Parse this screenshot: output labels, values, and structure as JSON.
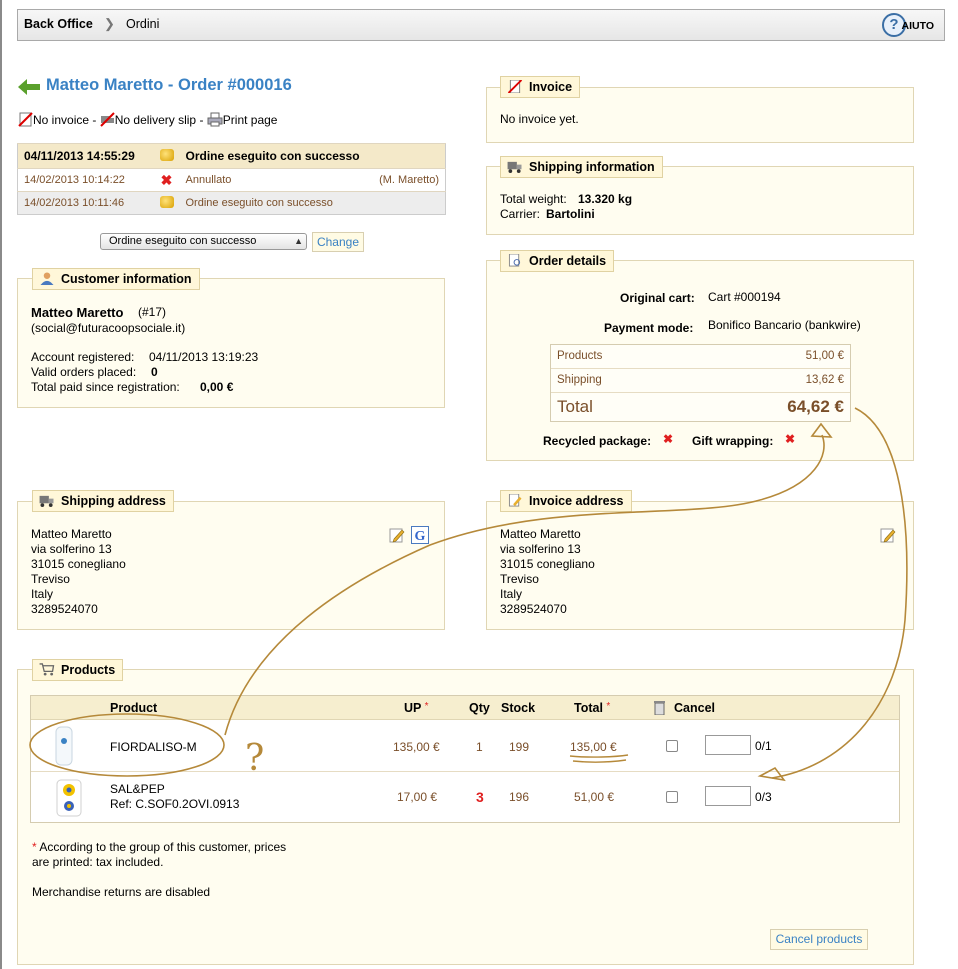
{
  "breadcrumb": {
    "root": "Back Office",
    "current": "Ordini",
    "help_label": "AIUTO"
  },
  "order": {
    "title": "Matteo Maretto - Order #000016"
  },
  "doc_links": {
    "invoice": "No invoice",
    "delivery": "No delivery slip",
    "print": "Print page",
    "sep": "-"
  },
  "history": [
    {
      "date": "04/11/2013 14:55:29",
      "status": "Ordine eseguito con successo",
      "by": ""
    },
    {
      "date": "14/02/2013 10:14:22",
      "status": "Annullato",
      "by": "(M. Maretto)"
    },
    {
      "date": "14/02/2013 10:11:46",
      "status": "Ordine eseguito con successo",
      "by": ""
    }
  ],
  "status_select": {
    "selected": "Ordine eseguito con successo",
    "button": "Change"
  },
  "customer": {
    "legend": "Customer information",
    "name": "Matteo Maretto",
    "id": "(#17)",
    "email": "(social@futuracoopsociale.it)",
    "registered_label": "Account registered:",
    "registered": "04/11/2013 13:19:23",
    "valid_label": "Valid orders placed:",
    "valid": "0",
    "paid_label": "Total paid since registration:",
    "paid": "0,00 €"
  },
  "invoice": {
    "legend": "Invoice",
    "text": "No invoice yet."
  },
  "shipping_info": {
    "legend": "Shipping information",
    "weight_label": "Total weight:",
    "weight": "13.320 kg",
    "carrier_label": "Carrier:",
    "carrier": "Bartolini"
  },
  "order_details": {
    "legend": "Order details",
    "cart_label": "Original cart:",
    "cart": "Cart #000194",
    "payment_label": "Payment mode:",
    "payment": "Bonifico Bancario (bankwire)",
    "products_label": "Products",
    "products": "51,00 €",
    "shipping_label": "Shipping",
    "shipping": "13,62 €",
    "total_label": "Total",
    "total": "64,62 €",
    "recycled_label": "Recycled package:",
    "gift_label": "Gift wrapping:"
  },
  "shipping_address": {
    "legend": "Shipping address",
    "lines": [
      "Matteo Maretto",
      "via solferino 13",
      "31015 conegliano",
      "Treviso",
      "Italy",
      "3289524070"
    ]
  },
  "invoice_address": {
    "legend": "Invoice address",
    "lines": [
      "Matteo Maretto",
      "via solferino 13",
      "31015 conegliano",
      "Treviso",
      "Italy",
      "3289524070"
    ]
  },
  "products": {
    "legend": "Products",
    "headers": {
      "product": "Product",
      "up": "UP",
      "qty": "Qty",
      "stock": "Stock",
      "total": "Total",
      "cancel": "Cancel",
      "asterisk": "*"
    },
    "rows": [
      {
        "name": "FIORDALISO-M",
        "ref": "",
        "up": "135,00 €",
        "qty": "1",
        "stock": "199",
        "total": "135,00 €",
        "returned": "0/1"
      },
      {
        "name": "SAL&PEP",
        "ref": "Ref: C.SOF0.2OVI.0913",
        "up": "17,00 €",
        "qty": "3",
        "stock": "196",
        "total": "51,00 €",
        "returned": "0/3"
      }
    ],
    "note_line1": "According to the group of this customer, prices",
    "note_line2": "are printed: tax included.",
    "returns": "Merchandise returns are disabled",
    "cancel_button": "Cancel products"
  },
  "annotation": {
    "question": "?"
  },
  "colors": {
    "link_blue": "#3a82c4",
    "legend_bg": "#fff7d9",
    "panel_bg": "#fffdf0",
    "value_brown": "#7a4f2a",
    "annotation": "#b5893a",
    "error_red": "#e02020"
  }
}
